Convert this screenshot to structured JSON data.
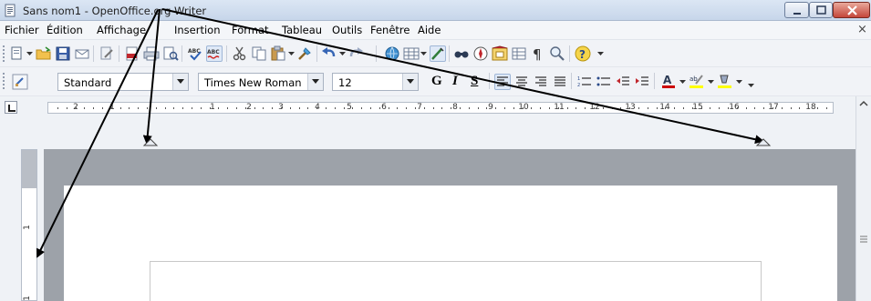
{
  "window": {
    "title": "Sans nom1 - OpenOffice.org Writer"
  },
  "menu": {
    "items": [
      {
        "label": "Fichier"
      },
      {
        "label": "Édition"
      },
      {
        "label": "Affichage"
      },
      {
        "label": "Insertion"
      },
      {
        "label": "Format"
      },
      {
        "label": "Tableau"
      },
      {
        "label": "Outils"
      },
      {
        "label": "Fenêtre"
      },
      {
        "label": "Aide"
      }
    ],
    "close_glyph": "×"
  },
  "formatting": {
    "paragraph_style": "Standard",
    "font_name": "Times New Roman",
    "font_size": "12",
    "bold_glyph": "G",
    "italic_glyph": "I",
    "underline_glyph": "S"
  },
  "ruler": {
    "labels": [
      "2",
      "1",
      "1",
      "2",
      "3",
      "4",
      "5",
      "6",
      "7",
      "8",
      "9",
      "10",
      "11",
      "12",
      "13",
      "14",
      "15",
      "16",
      "17",
      "18"
    ],
    "vertical_labels": [
      "1",
      "1"
    ]
  },
  "icons": {
    "new": "new-document-icon",
    "open": "open-folder-icon",
    "save": "save-icon",
    "email": "email-icon",
    "edit_file": "edit-file-icon",
    "pdf": "export-pdf-icon",
    "print": "print-icon",
    "preview": "page-preview-icon",
    "spell": "spellcheck-icon",
    "autospell": "autospellcheck-icon",
    "cut": "cut-icon",
    "copy": "copy-icon",
    "paste": "paste-icon",
    "clone": "clone-format-icon",
    "undo": "undo-icon",
    "redo": "redo-icon",
    "hyperlink": "hyperlink-icon",
    "table": "table-icon",
    "draw": "show-draw-functions-icon",
    "find": "find-replace-icon",
    "navigator": "navigator-icon",
    "gallery": "gallery-icon",
    "datasource": "data-sources-icon",
    "pilcrow": "formatting-marks-icon",
    "zoom": "zoom-icon",
    "help": "help-icon"
  },
  "colors": {
    "font_color": "#cc0000",
    "highlight": "#ffff00",
    "background_color": "#ffff00",
    "annotation_arrow": "#000000"
  }
}
